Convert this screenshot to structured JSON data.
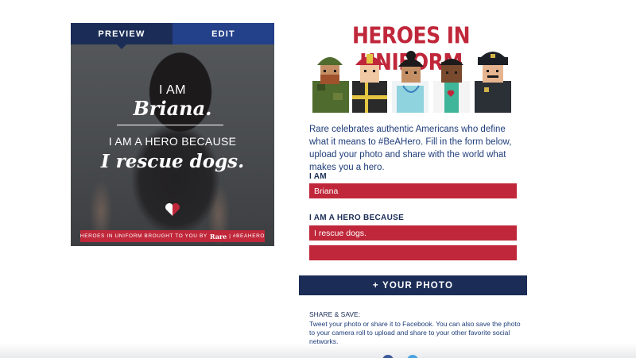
{
  "tabs": {
    "preview": "PREVIEW",
    "edit": "EDIT"
  },
  "card": {
    "i_am": "I AM",
    "name": "Briana.",
    "because": "I AM A HERO BECAUSE",
    "reason": "I rescue dogs.",
    "footer_prefix": "HEROES IN UNIFORM BROUGHT TO YOU BY",
    "footer_brand": "Rare",
    "footer_suffix": "| #BEAHERO"
  },
  "logo": {
    "title": "HEROES IN UNIFORM"
  },
  "intro": "Rare celebrates authentic Americans who define what it means to #BeAHero. Fill in the form below, upload your photo and share with the world what makes you a hero.",
  "form": {
    "iam_label": "I AM",
    "name_value": "Briana",
    "because_label": "I AM A HERO BECAUSE",
    "reason_line1": "I rescue dogs.",
    "reason_line2": ""
  },
  "photo_button": "+ YOUR PHOTO",
  "share": {
    "heading": "SHARE & SAVE:",
    "text": "Tweet your photo or share it to Facebook. You can also save the photo to your camera roll to upload and share to your other favorite social networks."
  },
  "colors": {
    "navy": "#1b2d57",
    "blue": "#23408a",
    "red": "#c0273a"
  }
}
